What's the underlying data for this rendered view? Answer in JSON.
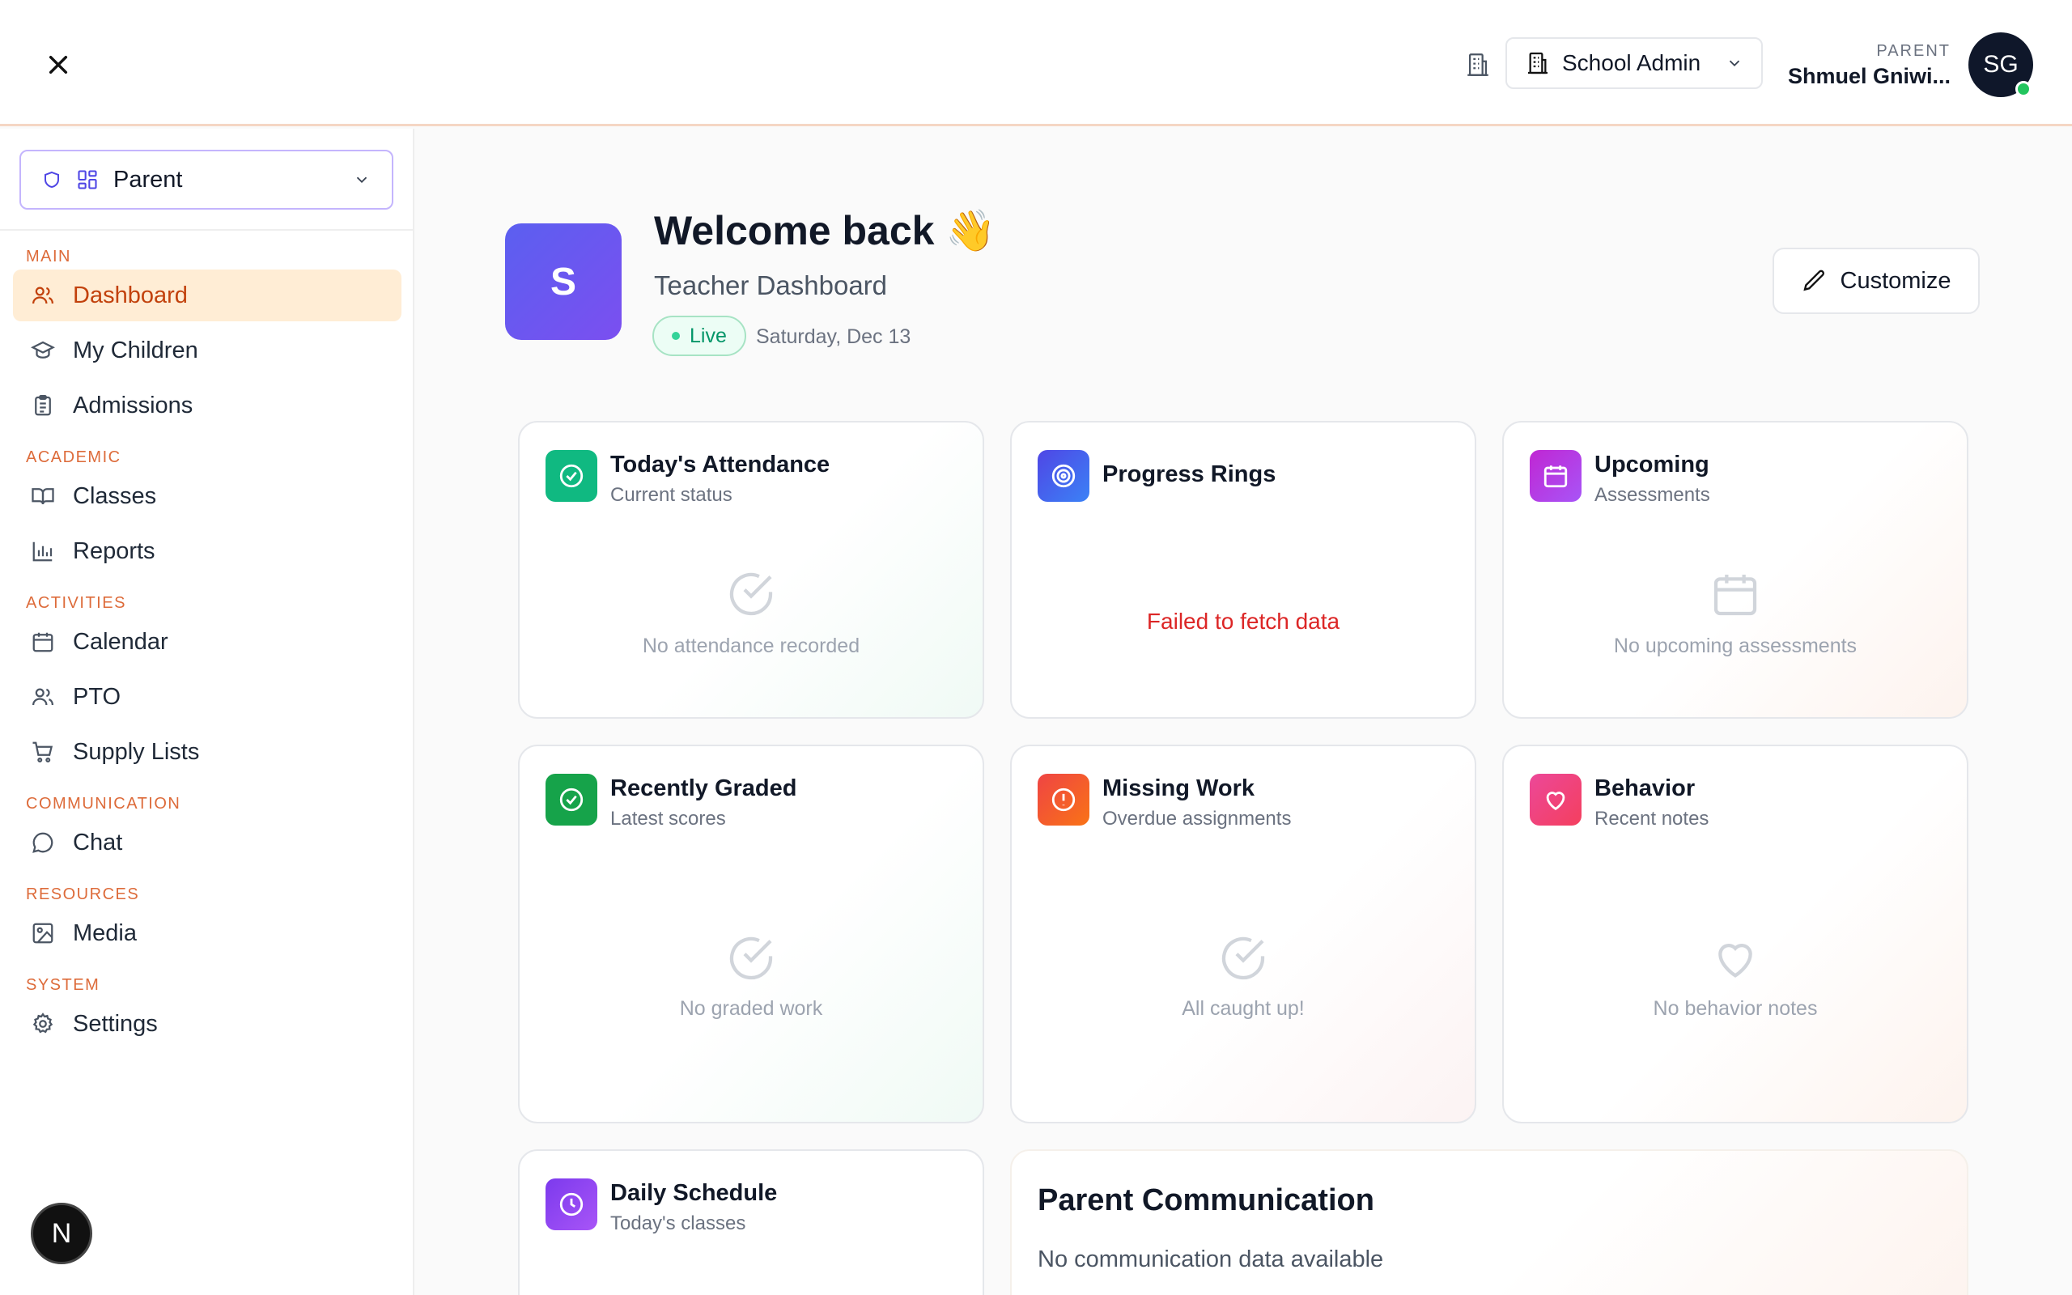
{
  "header": {
    "org_selector": "School Admin",
    "user_role": "PARENT",
    "user_name": "Shmuel Gniwi...",
    "avatar_initials": "SG"
  },
  "sidebar": {
    "role_selector": "Parent",
    "sections": [
      {
        "label": "MAIN",
        "items": [
          {
            "label": "Dashboard",
            "icon": "users-icon",
            "active": true
          },
          {
            "label": "My Children",
            "icon": "graduation-cap-icon"
          },
          {
            "label": "Admissions",
            "icon": "clipboard-icon"
          }
        ]
      },
      {
        "label": "ACADEMIC",
        "items": [
          {
            "label": "Classes",
            "icon": "book-open-icon"
          },
          {
            "label": "Reports",
            "icon": "bar-chart-icon"
          }
        ]
      },
      {
        "label": "ACTIVITIES",
        "items": [
          {
            "label": "Calendar",
            "icon": "calendar-icon"
          },
          {
            "label": "PTO",
            "icon": "users-icon"
          },
          {
            "label": "Supply Lists",
            "icon": "cart-icon"
          }
        ]
      },
      {
        "label": "COMMUNICATION",
        "items": [
          {
            "label": "Chat",
            "icon": "chat-icon"
          }
        ]
      },
      {
        "label": "RESOURCES",
        "items": [
          {
            "label": "Media",
            "icon": "image-icon"
          }
        ]
      },
      {
        "label": "SYSTEM",
        "items": [
          {
            "label": "Settings",
            "icon": "gear-icon"
          }
        ]
      }
    ],
    "dev_badge": "N"
  },
  "welcome": {
    "logo_letter": "S",
    "title": "Welcome back",
    "emoji": "👋",
    "subtitle": "Teacher Dashboard",
    "live_label": "Live",
    "date": "Saturday, Dec 13",
    "customize_label": "Customize"
  },
  "cards": {
    "attendance": {
      "title": "Today's Attendance",
      "subtitle": "Current status",
      "empty": "No attendance recorded"
    },
    "progress": {
      "title": "Progress Rings",
      "error": "Failed to fetch data"
    },
    "upcoming": {
      "title": "Upcoming",
      "subtitle": "Assessments",
      "empty": "No upcoming assessments"
    },
    "graded": {
      "title": "Recently Graded",
      "subtitle": "Latest scores",
      "empty": "No graded work"
    },
    "missing": {
      "title": "Missing Work",
      "subtitle": "Overdue assignments",
      "empty": "All caught up!"
    },
    "behavior": {
      "title": "Behavior",
      "subtitle": "Recent notes",
      "empty": "No behavior notes"
    },
    "schedule": {
      "title": "Daily Schedule",
      "subtitle": "Today's classes"
    },
    "communication": {
      "title": "Parent Communication",
      "text": "No communication data available"
    }
  },
  "colors": {
    "accent_orange": "#c2410c",
    "active_bg": "#ffedd5",
    "attendance_icon": "#10b981",
    "progress_icon": "#4f46e5",
    "upcoming_icon": "#c026d3",
    "graded_icon": "#16a34a",
    "missing_icon": "#ef4444",
    "behavior_icon": "#ec4899",
    "schedule_icon": "#7c3aed",
    "error_red": "#dc2626"
  }
}
